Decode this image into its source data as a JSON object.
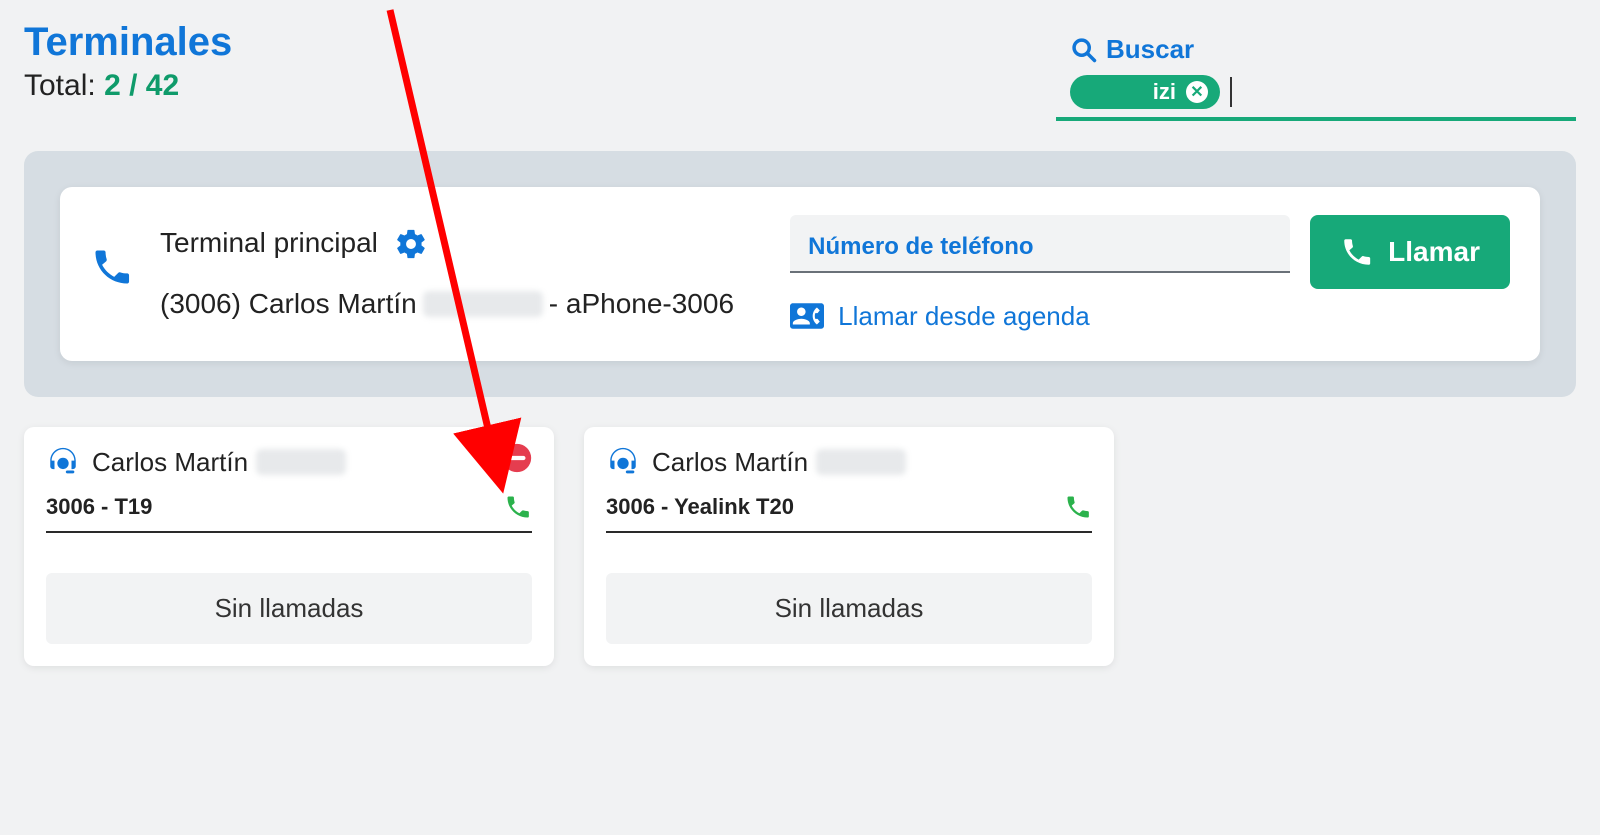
{
  "header": {
    "title": "Terminales",
    "total_label": "Total:",
    "count_shown": "2",
    "count_total": "42"
  },
  "search": {
    "label": "Buscar",
    "chip_text": "izi"
  },
  "main_terminal": {
    "title": "Terminal principal",
    "subtitle_prefix": "(3006) Carlos Martín",
    "subtitle_suffix": "- aPhone-3006",
    "phone_input_label": "Número de teléfono",
    "agenda_label": "Llamar desde agenda",
    "call_button": "Llamar"
  },
  "cards": [
    {
      "name": "Carlos Martín",
      "line2": "3006 - T19",
      "no_calls": "Sin llamadas",
      "dnd": true
    },
    {
      "name": "Carlos Martín",
      "line2": "3006 - Yealink T20",
      "no_calls": "Sin llamadas",
      "dnd": false
    }
  ],
  "colors": {
    "blue": "#1076d8",
    "green": "#17a979",
    "red": "#e53d4f"
  }
}
